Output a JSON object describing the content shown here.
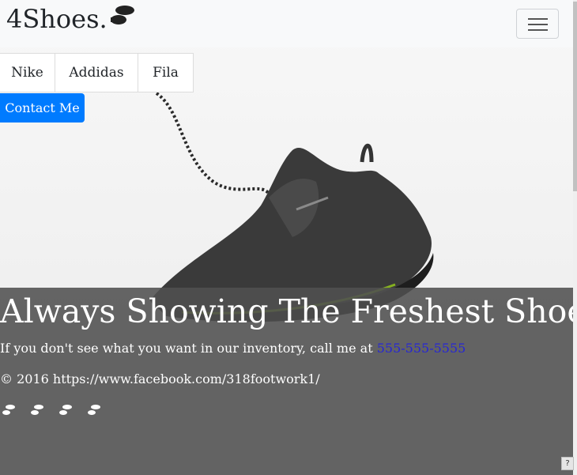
{
  "navbar": {
    "brand": "4Shoes.",
    "brand_logo_icon": "footprints-icon",
    "toggler_icon": "hamburger-icon"
  },
  "brands": {
    "tabs": [
      "Nike",
      "Addidas",
      "Fila"
    ]
  },
  "contact": {
    "label": "Contact Me"
  },
  "hero": {
    "image": "sneaker-photo",
    "headline": "Always Showing The Freshest Shoes",
    "subline_prefix": "If you don't see what you want in our inventory, call me at ",
    "phone": "555-555-5555",
    "footer": "© 2016 https://www.facebook.com/318footwork1/",
    "footprint_icons": [
      "footprints-icon",
      "footprints-icon",
      "footprints-icon",
      "footprints-icon"
    ]
  },
  "colors": {
    "accent": "#007bff",
    "overlay": "#505050",
    "link": "#2626d6"
  },
  "help": {
    "label": "?"
  }
}
